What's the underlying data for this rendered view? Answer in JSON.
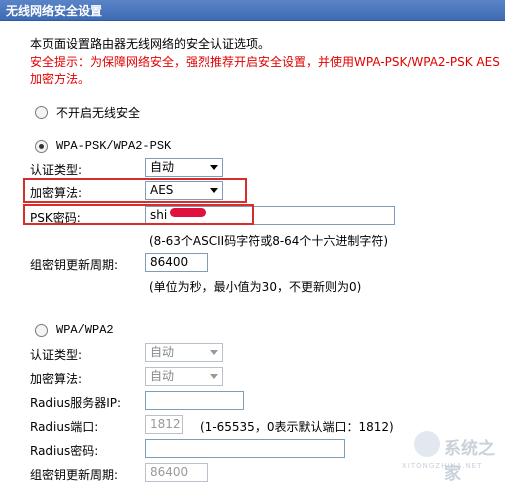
{
  "header": {
    "title": "无线网络安全设置"
  },
  "intro": {
    "line1": "本页面设置路由器无线网络的安全认证选项。",
    "warn1": "安全提示：为保障网络安全，强烈推荐开启安全设置，并使用WPA-PSK/WPA2-PSK AES",
    "warn2": "加密方法。"
  },
  "none_option": {
    "label": "不开启无线安全"
  },
  "psk": {
    "title": "WPA-PSK/WPA2-PSK",
    "auth_label": "认证类型:",
    "auth_value": "自动",
    "enc_label": "加密算法:",
    "enc_value": "AES",
    "pwd_label": "PSK密码:",
    "pwd_value": "shi",
    "pwd_hint": "(8-63个ASCII码字符或8-64个十六进制字符)",
    "period_label": "组密钥更新周期:",
    "period_value": "86400",
    "period_hint": "(单位为秒，最小值为30，不更新则为0)"
  },
  "wpa": {
    "title": "WPA/WPA2",
    "auth_label": "认证类型:",
    "auth_value": "自动",
    "enc_label": "加密算法:",
    "enc_value": "自动",
    "ip_label": "Radius服务器IP:",
    "ip_value": "",
    "port_label": "Radius端口:",
    "port_value": "1812",
    "port_hint": "(1-65535，0表示默认端口：1812)",
    "pwd_label": "Radius密码:",
    "pwd_value": "",
    "period_label": "组密钥更新周期:",
    "period_value": "86400"
  },
  "watermark": {
    "text": "系统之家",
    "sub": "XITONGZHIJIA.NET"
  }
}
